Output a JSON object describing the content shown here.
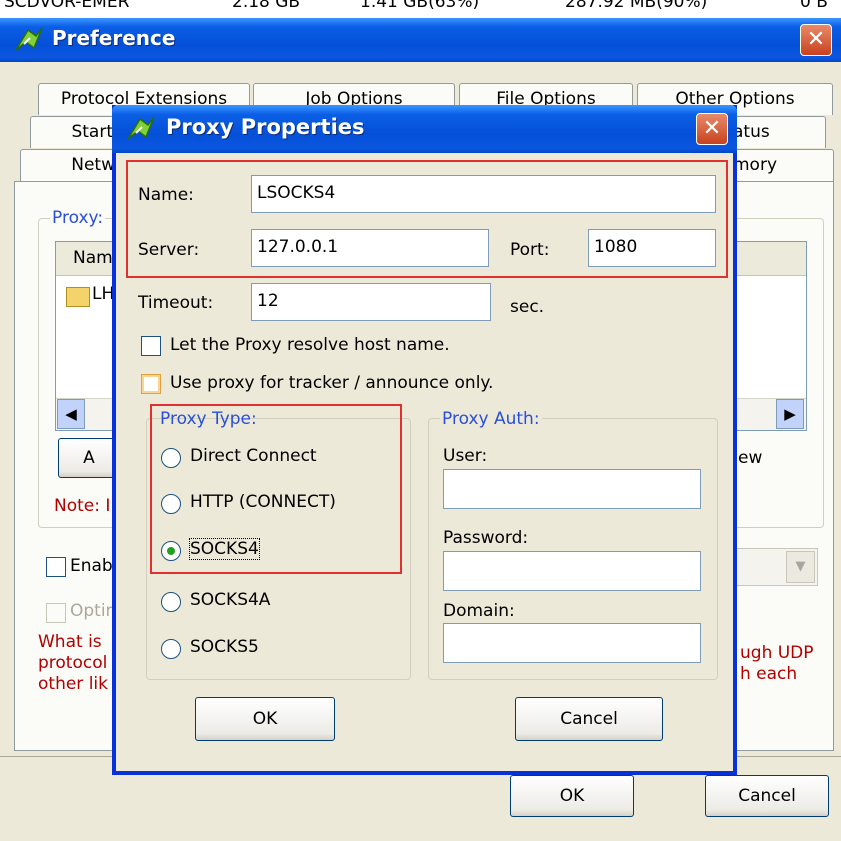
{
  "background_strip": {
    "name": "SCDVOR-EMER",
    "size": "2.18 GB",
    "used": "1.41 GB(63%)",
    "free": "287.92 MB(90%)",
    "extra": "0 B"
  },
  "preference": {
    "title": "Preference",
    "close": "✕",
    "tabs_row1": [
      "Protocol Extensions",
      "Job Options",
      "File Options",
      "Other Options"
    ],
    "tabs_row2_left": "Start",
    "tabs_row2_right": "atus",
    "tabs_row3_left": "Netw",
    "tabs_row3_right": "mory",
    "proxy_group_label": "Proxy:",
    "list_header": "Nam",
    "list_item": "LH",
    "add_button": "A",
    "new_button": "ew",
    "note": "Note: I",
    "enable_label": "Enab",
    "optimize_label": "Optir",
    "what_line1": "What is",
    "what_line2": "protocol",
    "what_line3": "other lik",
    "right_line1": "ugh UDP",
    "right_line2": "h each",
    "ok": "OK",
    "cancel": "Cancel"
  },
  "proxy_dialog": {
    "title": "Proxy Properties",
    "close": "✕",
    "name_label": "Name:",
    "name_value": "LSOCKS4",
    "server_label": "Server:",
    "server_value": "127.0.0.1",
    "port_label": "Port:",
    "port_value": "1080",
    "timeout_label": "Timeout:",
    "timeout_value": "12",
    "timeout_unit": "sec.",
    "resolve_label": "Let the Proxy resolve host name.",
    "resolve_checked": false,
    "tracker_label": "Use proxy for tracker / announce only.",
    "tracker_checked": false,
    "proxy_type_label": "Proxy Type:",
    "types": [
      "Direct Connect",
      "HTTP (CONNECT)",
      "SOCKS4",
      "SOCKS4A",
      "SOCKS5"
    ],
    "selected_type": "SOCKS4",
    "auth_label": "Proxy Auth:",
    "user_label": "User:",
    "user_value": "",
    "password_label": "Password:",
    "password_value": "",
    "domain_label": "Domain:",
    "domain_value": "",
    "ok": "OK",
    "cancel": "Cancel"
  },
  "colors": {
    "titlebar": "#0550d8",
    "dialog_bg": "#ece9d8",
    "highlight_frame": "#e03030",
    "group_label": "#2a4fd6",
    "note_text": "#b00000"
  }
}
